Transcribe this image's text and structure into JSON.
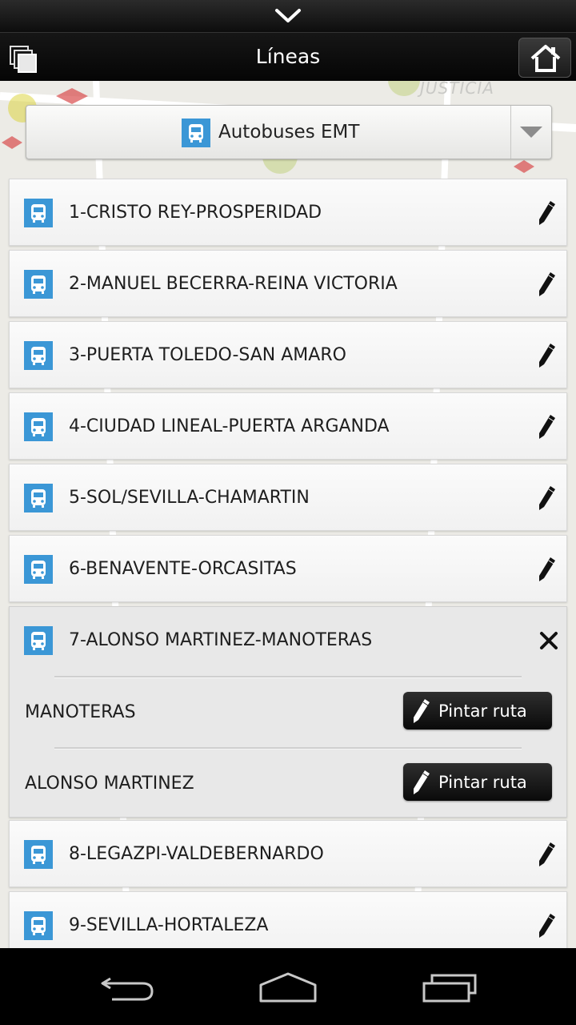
{
  "header": {
    "title": "Líneas"
  },
  "selector": {
    "value": "Autobuses EMT"
  },
  "lines": [
    {
      "label": "1-CRISTO REY-PROSPERIDAD"
    },
    {
      "label": "2-MANUEL BECERRA-REINA VICTORIA"
    },
    {
      "label": "3-PUERTA TOLEDO-SAN AMARO"
    },
    {
      "label": "4-CIUDAD LINEAL-PUERTA ARGANDA"
    },
    {
      "label": "5-SOL/SEVILLA-CHAMARTIN"
    },
    {
      "label": "6-BENAVENTE-ORCASITAS"
    },
    {
      "label": "8-LEGAZPI-VALDEBERNARDO"
    },
    {
      "label": "9-SEVILLA-HORTALEZA"
    }
  ],
  "expanded_line": {
    "label": "7-ALONSO MARTINEZ-MANOTERAS",
    "directions": [
      {
        "name": "MANOTERAS",
        "button": "Pintar ruta"
      },
      {
        "name": "ALONSO MARTINEZ",
        "button": "Pintar ruta"
      }
    ]
  },
  "map_labels": {
    "justicia": "JUSTICIA"
  },
  "colors": {
    "bus_icon": "#3b97d6",
    "title_text": "#ffffff",
    "button_bg": "#111111"
  },
  "icons": [
    "chevron-down-icon",
    "windows-icon",
    "home-icon",
    "bus-icon",
    "pencil-icon",
    "close-icon",
    "back-icon",
    "home-nav-icon",
    "recent-apps-icon"
  ]
}
